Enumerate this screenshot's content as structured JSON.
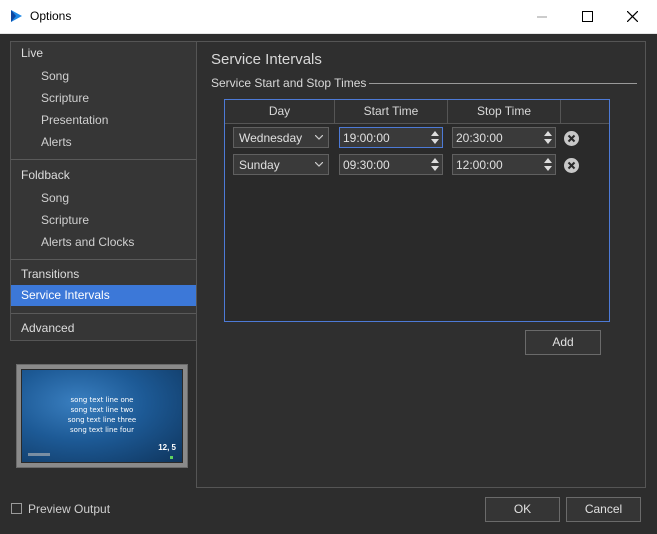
{
  "window": {
    "title": "Options",
    "icon": "play-logo-icon",
    "accent": "#3c78d8"
  },
  "sidebar": {
    "groups": [
      {
        "label": "Live",
        "items": [
          "Song",
          "Scripture",
          "Presentation",
          "Alerts"
        ]
      },
      {
        "label": "Foldback",
        "items": [
          "Song",
          "Scripture",
          "Alerts and Clocks"
        ]
      },
      {
        "label": "Transitions",
        "items": []
      },
      {
        "label": "Service Intervals",
        "items": [],
        "selected": true
      },
      {
        "label": "Advanced",
        "items": []
      }
    ]
  },
  "preview": {
    "lines": [
      "song text line one",
      "song text line two",
      "song text line three",
      "song text line four"
    ],
    "counter": "12, 5"
  },
  "main": {
    "heading": "Service Intervals",
    "subheading": "Service Start and Stop Times",
    "table": {
      "columns": [
        "Day",
        "Start Time",
        "Stop Time"
      ],
      "rows": [
        {
          "day": "Wednesday",
          "start": "19:00:00",
          "stop": "20:30:00"
        },
        {
          "day": "Sunday",
          "start": "09:30:00",
          "stop": "12:00:00"
        }
      ]
    },
    "add_label": "Add"
  },
  "footer": {
    "preview_output_label": "Preview Output",
    "preview_output_checked": false,
    "ok_label": "OK",
    "cancel_label": "Cancel"
  }
}
